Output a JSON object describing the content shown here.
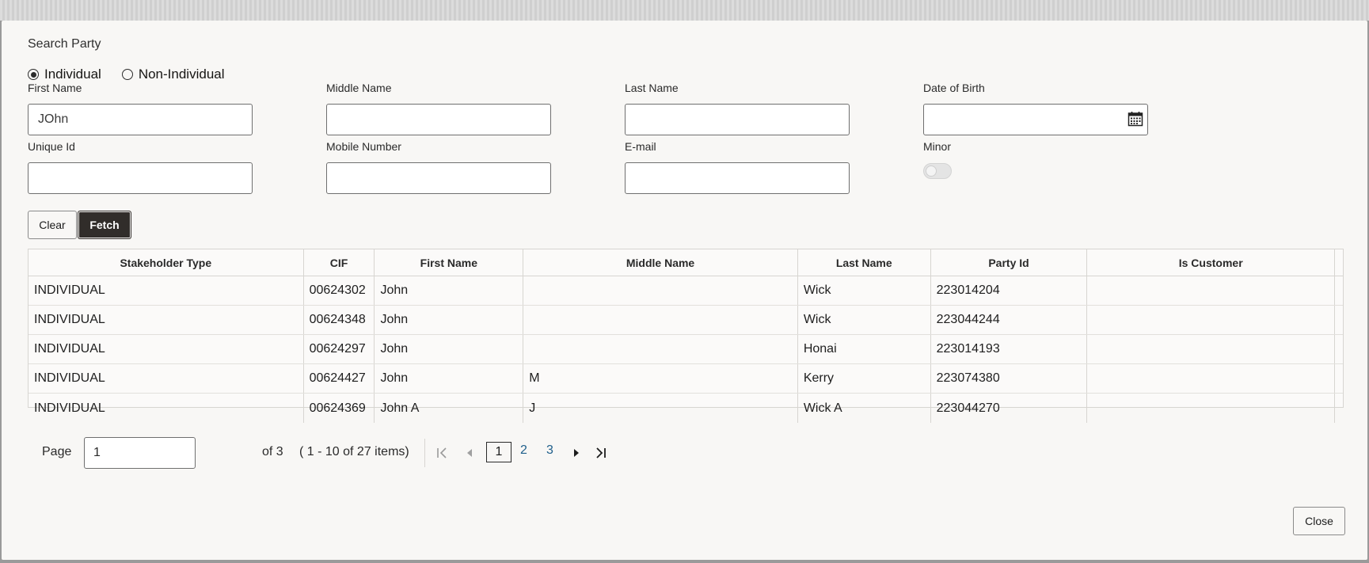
{
  "dialog": {
    "title": "Search Party"
  },
  "party_type": {
    "options": [
      {
        "label": "Individual",
        "selected": true
      },
      {
        "label": "Non-Individual",
        "selected": false
      }
    ]
  },
  "fields": {
    "first_name": {
      "label": "First Name",
      "value": "JOhn"
    },
    "middle_name": {
      "label": "Middle Name",
      "value": ""
    },
    "last_name": {
      "label": "Last Name",
      "value": ""
    },
    "dob": {
      "label": "Date of Birth",
      "value": "",
      "icon": "calendar-icon"
    },
    "unique_id": {
      "label": "Unique Id",
      "value": ""
    },
    "mobile": {
      "label": "Mobile Number",
      "value": ""
    },
    "email": {
      "label": "E-mail",
      "value": ""
    },
    "minor": {
      "label": "Minor",
      "checked": false
    }
  },
  "buttons": {
    "clear": "Clear",
    "fetch": "Fetch",
    "close": "Close"
  },
  "table": {
    "columns": [
      "Stakeholder Type",
      "CIF",
      "First Name",
      "Middle Name",
      "Last Name",
      "Party Id",
      "Is Customer"
    ],
    "rows": [
      [
        "INDIVIDUAL",
        "00624302",
        "John",
        "",
        "Wick",
        "223014204",
        ""
      ],
      [
        "INDIVIDUAL",
        "00624348",
        "John",
        "",
        "Wick",
        "223044244",
        ""
      ],
      [
        "INDIVIDUAL",
        "00624297",
        "John",
        "",
        "Honai",
        "223014193",
        ""
      ],
      [
        "INDIVIDUAL",
        "00624427",
        "John",
        "M",
        "Kerry",
        "223074380",
        ""
      ],
      [
        "INDIVIDUAL",
        "00624369",
        "John A",
        "J",
        "Wick A",
        "223044270",
        ""
      ]
    ]
  },
  "pagination": {
    "page_label": "Page",
    "page_value": "1",
    "of_text": "of 3",
    "items_text": "( 1 - 10 of 27 items)",
    "current": "1",
    "pages": [
      "2",
      "3"
    ]
  }
}
